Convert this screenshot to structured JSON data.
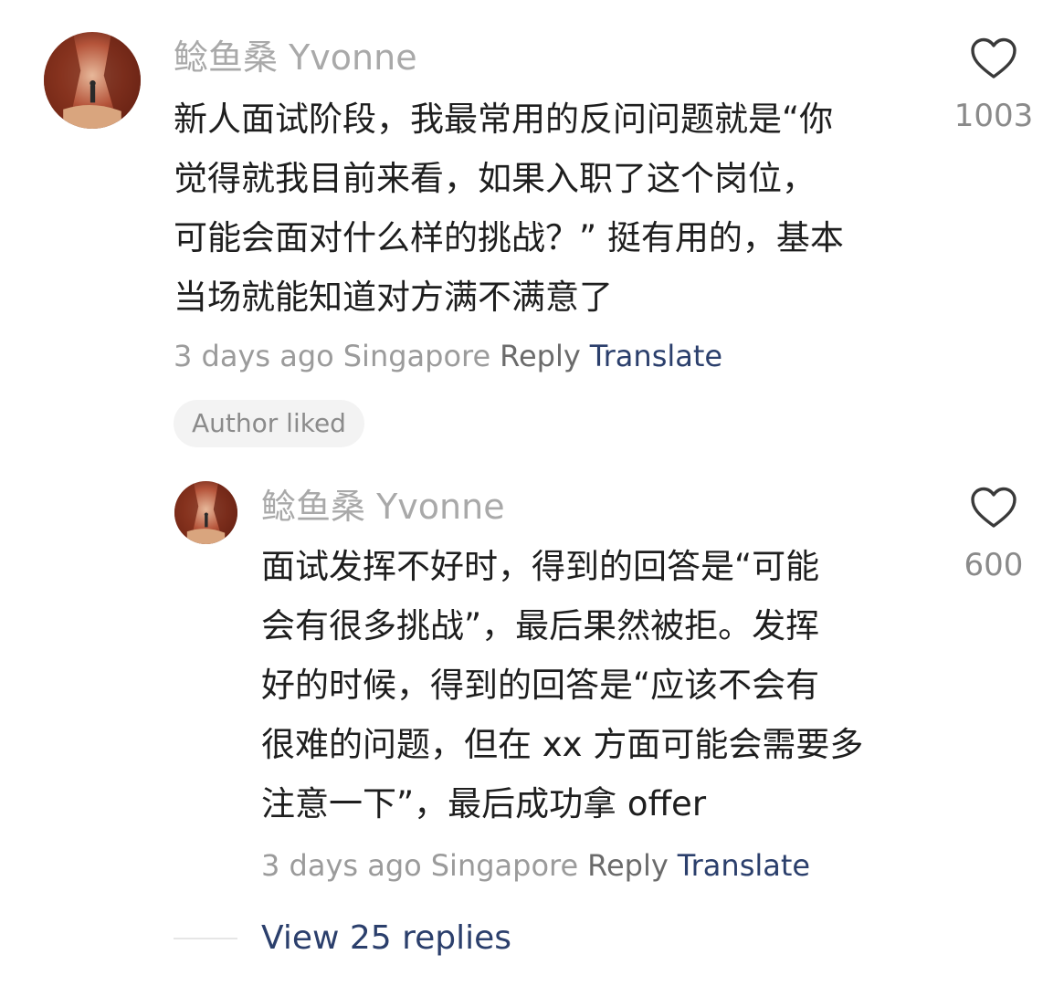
{
  "comment": {
    "username": "鲶鱼桑 Yvonne",
    "lines": [
      "新人面试阶段，我最常用的反问问题就是“你",
      "觉得就我目前来看，如果入职了这个岗位，",
      "可能会面对什么样的挑战？” 挺有用的，基本",
      "当场就能知道对方满不满意了"
    ],
    "time": "3 days ago",
    "location": "Singapore",
    "reply_label": "Reply",
    "translate_label": "Translate",
    "likes": "1003",
    "badge": "Author liked",
    "heart_icon": "heart-outline-icon"
  },
  "reply": {
    "username": "鲶鱼桑 Yvonne",
    "lines": [
      "面试发挥不好时，得到的回答是“可能",
      "会有很多挑战”，最后果然被拒。发挥",
      "好的时候，得到的回答是“应该不会有",
      "很难的问题，但在 xx 方面可能会需要多",
      "注意一下”，最后成功拿 offer"
    ],
    "time": "3 days ago",
    "location": "Singapore",
    "reply_label": "Reply",
    "translate_label": "Translate",
    "likes": "600",
    "heart_icon": "heart-outline-icon"
  },
  "view_replies": "View 25 replies",
  "colors": {
    "username": "#a9a9a9",
    "body_text": "#1e1e1e",
    "meta": "#9b9b9b",
    "link": "#2b3f6c",
    "badge_bg": "#f3f3f3"
  }
}
